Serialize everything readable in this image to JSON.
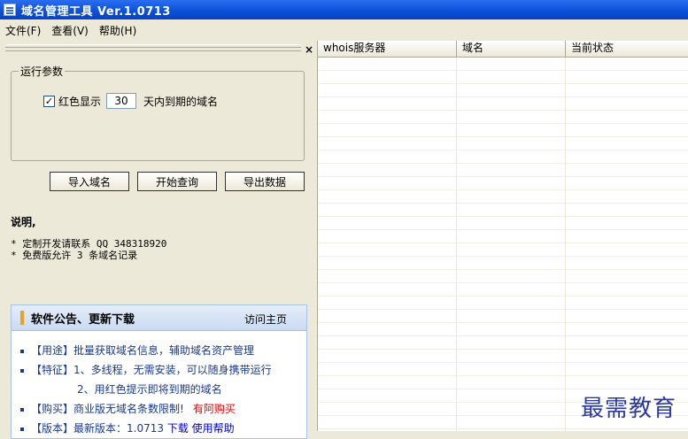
{
  "window": {
    "title": "域名管理工具 Ver.1.0713"
  },
  "menu": [
    "文件(F)",
    "查看(V)",
    "帮助(H)"
  ],
  "dock": {
    "close": "×"
  },
  "params": {
    "group_title": "运行参数",
    "checkbox_checked": true,
    "checkbox_mark": "✓",
    "checkbox_label": "红色显示",
    "days_value": "30",
    "suffix": "天内到期的域名"
  },
  "buttons": {
    "import": "导入域名",
    "start": "开始查询",
    "export": "导出数据"
  },
  "description": {
    "title": "说明,",
    "lines": [
      "* 定制开发请联系 QQ 348318920",
      "* 免费版允许 3 条域名记录"
    ]
  },
  "announcement": {
    "title": "软件公告、更新下载",
    "visit_link": "访问主页",
    "items": [
      {
        "text": "【用途】批量获取域名信息，辅助域名资产管理"
      },
      {
        "text": "【特征】1、多线程，无需安装，可以随身携带运行"
      },
      {
        "text": "2、用红色提示即将到期的域名"
      },
      {
        "text": "【购买】商业版无域名条数限制!",
        "link": "有阿购买"
      },
      {
        "text": "【版本】最新版本：1.0713",
        "link1": "下载",
        "link2": "使用帮助"
      }
    ]
  },
  "grid": {
    "columns": [
      "whois服务器",
      "域名",
      "当前状态"
    ]
  },
  "watermark": "最需教育"
}
